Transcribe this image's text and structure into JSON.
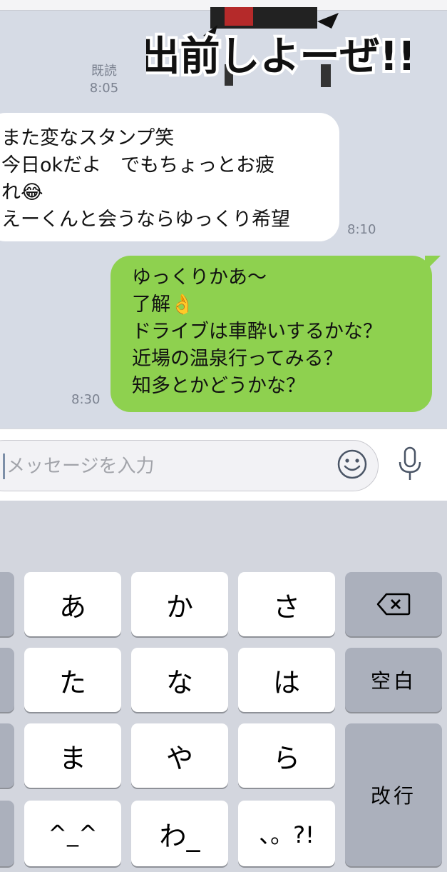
{
  "chat": {
    "read_label": "既読",
    "read_time": "8:05",
    "sticker_text": "出前しよーぜ!!",
    "incoming": {
      "text": "また変なスタンプ笑\n今日okだよ　でもちょっとお疲\nれ😂\nえーくんと会うならゆっくり希望",
      "time": "8:10"
    },
    "outgoing": {
      "text": "ゆっくりかあ〜\n了解👌\nドライブは車酔いするかな？\n近場の温泉行ってみる？\n知多とかどうかな？",
      "time": "8:30"
    }
  },
  "input": {
    "placeholder": "メッセージを入力",
    "emoji_icon": "smiley-icon",
    "mic_icon": "microphone-icon"
  },
  "keyboard": {
    "row1": [
      "あ",
      "か",
      "さ"
    ],
    "row2": [
      "た",
      "な",
      "は"
    ],
    "row3": [
      "ま",
      "や",
      "ら"
    ],
    "row4": [
      "^_^",
      "わ_",
      "、。?!"
    ],
    "delete_icon": "backspace-icon",
    "space_label": "空白",
    "return_label": "改行"
  },
  "colors": {
    "chat_bg": "#d6dbe5",
    "outgoing_bubble": "#8ed14f",
    "incoming_bubble": "#ffffff",
    "keyboard_bg": "#d3d6de",
    "dark_key": "#abb0bc"
  }
}
